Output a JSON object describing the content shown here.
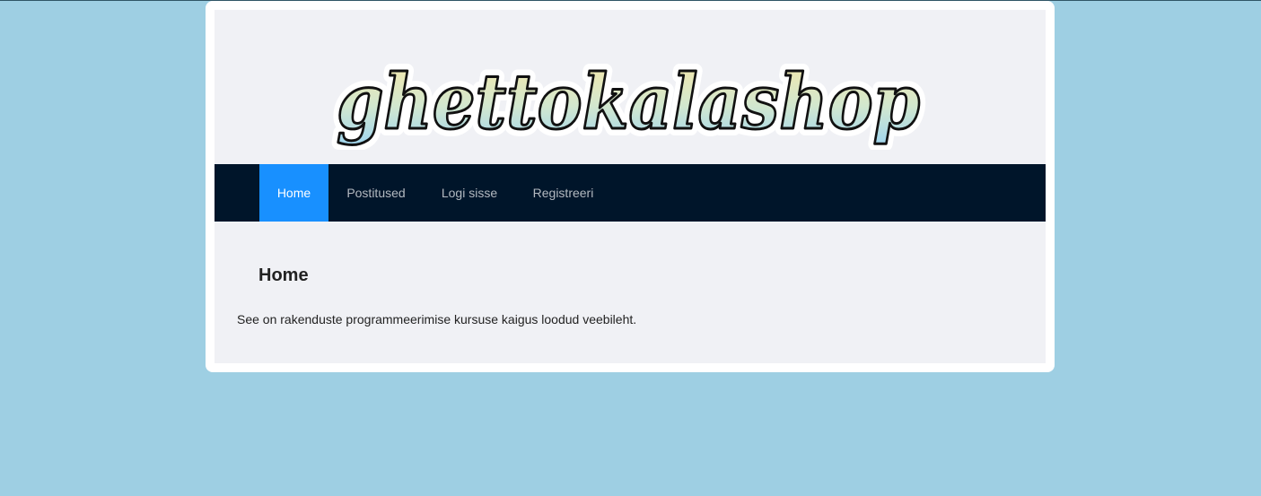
{
  "brand": {
    "logo_text": "ghettokalashop"
  },
  "nav": {
    "items": [
      {
        "label": "Home",
        "active": true
      },
      {
        "label": "Postitused",
        "active": false
      },
      {
        "label": "Logi sisse",
        "active": false
      },
      {
        "label": "Registreeri",
        "active": false
      }
    ]
  },
  "main": {
    "title": "Home",
    "text": "See on rakenduste programmeerimise kursuse kaigus loodud veebileht."
  },
  "colors": {
    "page_background": "#9ecfe3",
    "navbar_background": "#00152a",
    "active_nav": "#1890ff"
  }
}
